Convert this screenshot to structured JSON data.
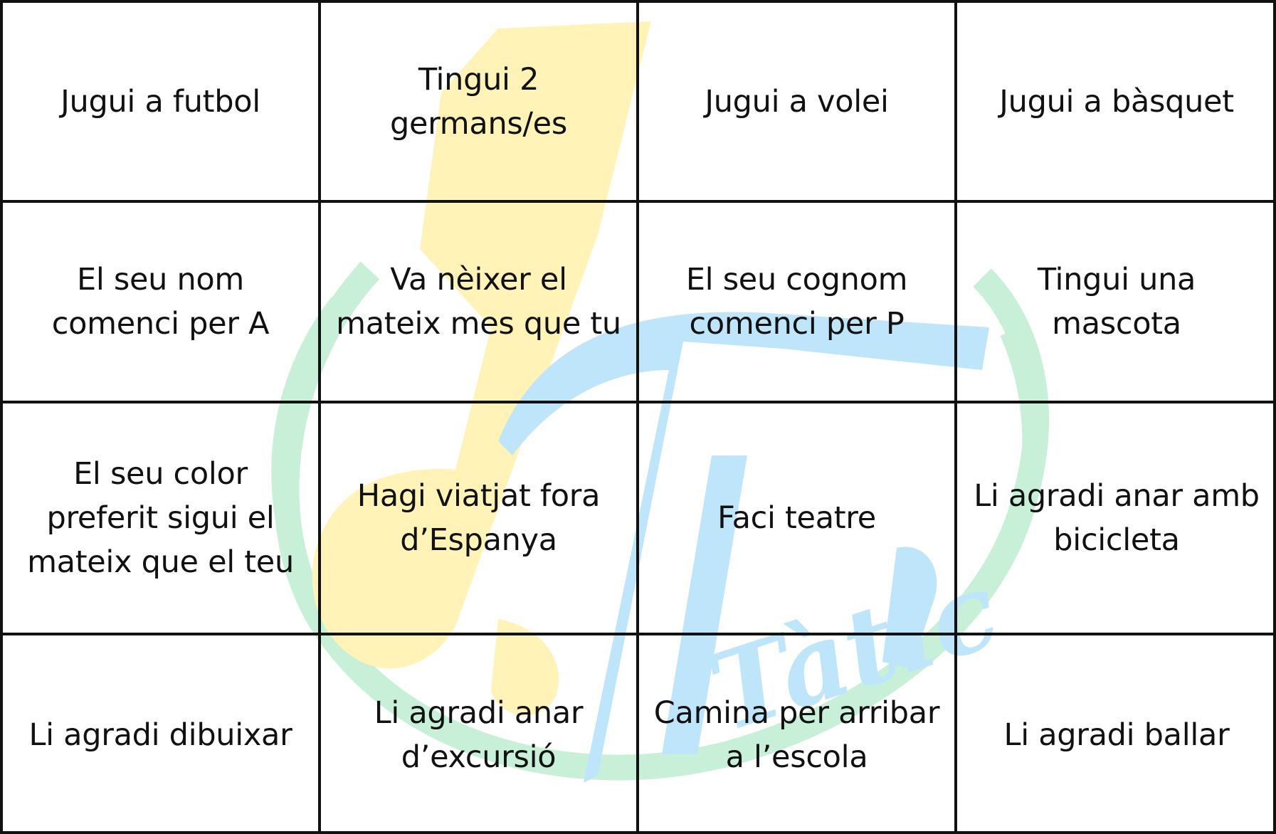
{
  "colors": {
    "grid_line": "#111111",
    "text": "#111111",
    "background": "#ffffff",
    "watermark_yellow": "#fff3b8",
    "watermark_blue": "#bfe5fb",
    "watermark_green": "#c8f0d9"
  },
  "watermark": {
    "description_icon": "logo-watermark",
    "script_text": "Tàtic"
  },
  "cells": [
    [
      "Jugui a futbol",
      "Tingui 2\ngermans/es",
      "Jugui a volei",
      "Jugui a bàsquet"
    ],
    [
      "El seu nom\ncomenci per A",
      "Va nèixer el\nmateix mes que tu",
      "El seu cognom\ncomenci per P",
      "Tingui una\nmascota"
    ],
    [
      "El seu color\npreferit sigui el\nmateix que el teu",
      "Hagi viatjat fora\nd’Espanya",
      "Faci teatre",
      "Li agradi anar amb\nbicicleta"
    ],
    [
      "Li agradi dibuixar",
      "Li agradi anar\nd’excursió",
      "Camina per arribar\na l’escola",
      "Li agradi ballar"
    ]
  ]
}
